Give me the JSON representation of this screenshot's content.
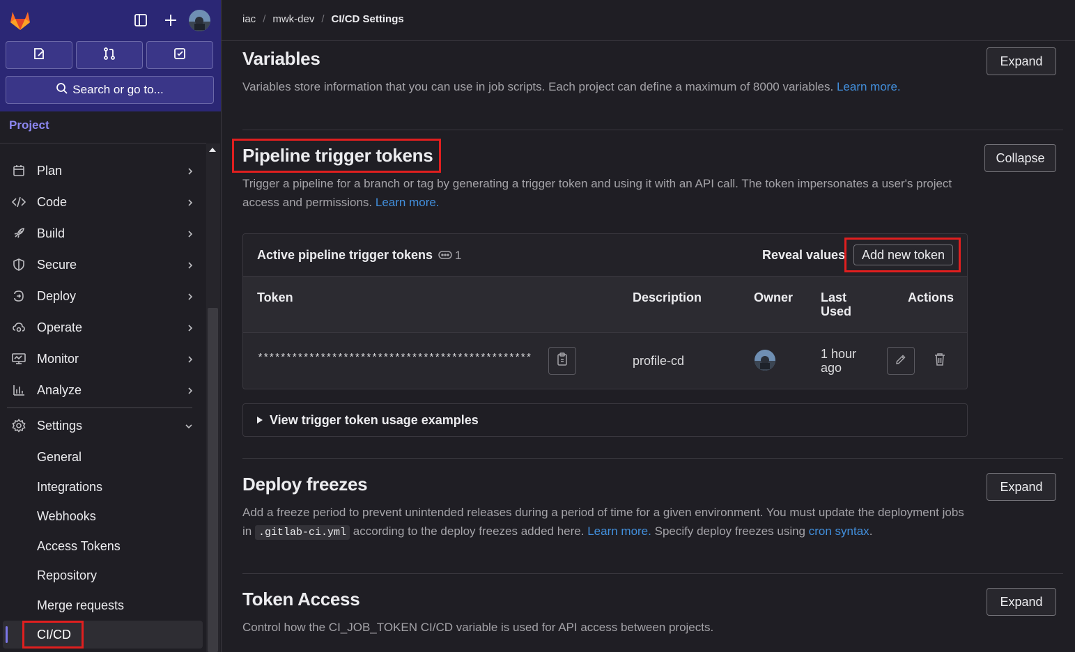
{
  "breadcrumb": [
    "iac",
    "mwk-dev",
    "CI/CD Settings"
  ],
  "sidebar": {
    "search_label": "Search or go to...",
    "context_label": "Project",
    "items": [
      {
        "label": "Plan",
        "icon": "plan-icon"
      },
      {
        "label": "Code",
        "icon": "code-icon"
      },
      {
        "label": "Build",
        "icon": "rocket-icon"
      },
      {
        "label": "Secure",
        "icon": "shield-icon"
      },
      {
        "label": "Deploy",
        "icon": "deployments-icon"
      },
      {
        "label": "Operate",
        "icon": "cloud-gear-icon"
      },
      {
        "label": "Monitor",
        "icon": "monitor-icon"
      },
      {
        "label": "Analyze",
        "icon": "chart-icon"
      },
      {
        "label": "Settings",
        "icon": "settings-icon"
      }
    ],
    "settings_sub": [
      "General",
      "Integrations",
      "Webhooks",
      "Access Tokens",
      "Repository",
      "Merge requests",
      "CI/CD"
    ]
  },
  "variables": {
    "title": "Variables",
    "desc": "Variables store information that you can use in job scripts. Each project can define a maximum of 8000 variables.",
    "link": "Learn more.",
    "button": "Expand"
  },
  "triggers": {
    "title": "Pipeline trigger tokens",
    "desc": "Trigger a pipeline for a branch or tag by generating a trigger token and using it with an API call. The token impersonates a user's project access and permissions.",
    "link": "Learn more.",
    "button": "Collapse",
    "card_title": "Active pipeline trigger tokens",
    "count": "1",
    "reveal": "Reveal values",
    "add": "Add new token",
    "columns": {
      "token": "Token",
      "description": "Description",
      "owner": "Owner",
      "last_used_1": "Last",
      "last_used_2": "Used",
      "actions": "Actions"
    },
    "row": {
      "token": "************************************************",
      "description": "profile-cd",
      "last_used_1": "1 hour",
      "last_used_2": "ago"
    },
    "examples": "View trigger token usage examples"
  },
  "freezes": {
    "title": "Deploy freezes",
    "desc_a": "Add a freeze period to prevent unintended releases during a period of time for a given environment. You must update the deployment jobs in",
    "code": ".gitlab-ci.yml",
    "desc_b": "according to the deploy freezes added here.",
    "link1": "Learn more.",
    "desc_c": "Specify deploy freezes using",
    "link2": "cron syntax",
    "desc_d": ".",
    "button": "Expand"
  },
  "token_access": {
    "title": "Token Access",
    "desc": "Control how the CI_JOB_TOKEN CI/CD variable is used for API access between projects.",
    "button": "Expand"
  },
  "colors": {
    "accent": "#428fdc",
    "sidebar_top": "#2b2775",
    "highlight": "#e01f1f"
  }
}
